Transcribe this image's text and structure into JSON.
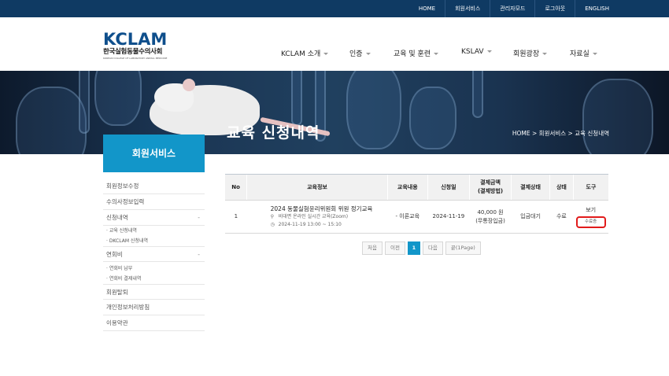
{
  "topbar": {
    "links": [
      "HOME",
      "회원서비스",
      "관리자모드",
      "로그아웃",
      "ENGLISH"
    ]
  },
  "logo": {
    "mark": "KCLAM",
    "korean_name": "한국실험동물수의사회",
    "english_name": "KOREAN COLLEGE OF LABORATORY ANIMAL MEDICINE"
  },
  "gnb": {
    "items": [
      "KCLAM 소개",
      "인증",
      "교육 및 훈련",
      "KSLAV",
      "회원광장",
      "자료실"
    ]
  },
  "hero": {
    "title": "교육 신청내역",
    "breadcrumb": "HOME > 회원서비스 > 교육 신청내역"
  },
  "sidebar": {
    "title": "회원서비스",
    "items": [
      {
        "label": "회원정보수정"
      },
      {
        "label": "수의사정보입력"
      },
      {
        "label": "신청내역",
        "toggle": "-"
      },
      {
        "label": "· 교육 신청내역"
      },
      {
        "label": "· DKCLAM 신청내역"
      },
      {
        "label": "연회비",
        "toggle": "-"
      },
      {
        "label": "· 연회비 납부"
      },
      {
        "label": "· 연회비 결제내역"
      },
      {
        "label": "회원탈퇴"
      },
      {
        "label": "개인정보처리방침"
      },
      {
        "label": "이용약관"
      }
    ]
  },
  "table": {
    "headers": [
      "No",
      "교육정보",
      "교육내용",
      "신청일",
      "결제금액\n(결제방법)",
      "결제상태",
      "상태",
      "도구"
    ],
    "rows": [
      {
        "no": "1",
        "title": "2024 동물실험윤리위원회 위원 정기교육",
        "location": "비대면 온라인 실시간 교육(Zoom)",
        "datetime": "2024-11-19 13:00 ~ 15:10",
        "content": "- 이론교육",
        "applied": "2024-11-19",
        "amount": "40,000 원",
        "method": "(무통장입금)",
        "pay_status": "입금대기",
        "status": "수료",
        "view_label": "보기",
        "cert_label": "수료증"
      }
    ]
  },
  "paging": {
    "first": "처음",
    "prev": "이전",
    "current": "1",
    "next": "다음",
    "last": "끝(1Page)"
  },
  "colors": {
    "topbar": "#0f3a63",
    "accent": "#1296c9",
    "highlight": "#e11b1b"
  }
}
